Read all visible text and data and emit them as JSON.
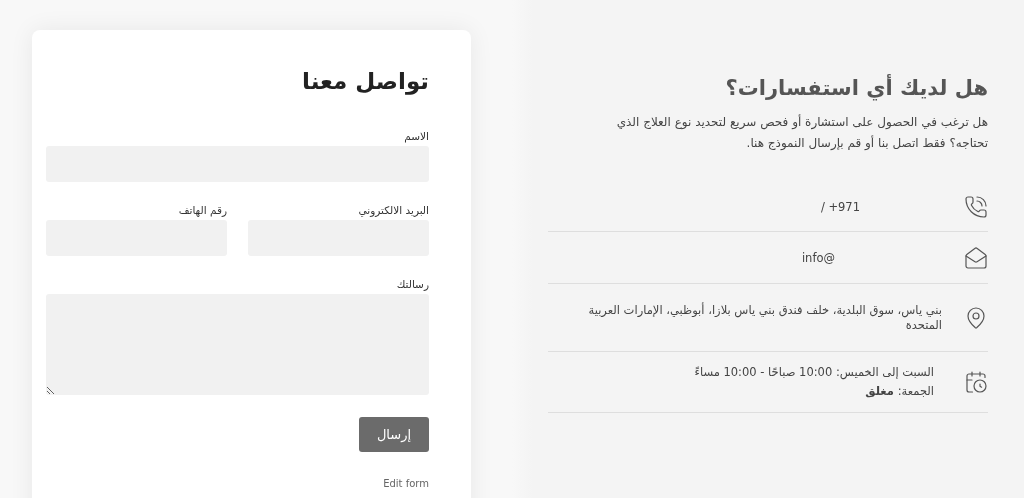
{
  "form": {
    "title": "تواصل معنا",
    "fields": [
      {
        "label": "الاسم",
        "kind": "wide"
      },
      {
        "label": "البريد الالكتروني",
        "kind": "half"
      },
      {
        "label": "رقم الهاتف",
        "kind": "half"
      },
      {
        "label": "رسالتك",
        "kind": "textarea"
      }
    ],
    "submit": "إرسال",
    "edit_link": "Edit form"
  },
  "info": {
    "title": "هل لديك أي استفسارات؟",
    "text": "هل ترغب في الحصول على استشارة أو فحص سريع لتحديد نوع العلاج الذي تحتاجه؟ فقط اتصل بنا أو قم بإرسال النموذج هنا.",
    "items": [
      {
        "kind": "phone",
        "lines": [
          "/ +971"
        ]
      },
      {
        "kind": "email",
        "lines": [
          "info@"
        ]
      },
      {
        "kind": "address",
        "lines": [
          "بني ياس، سوق البلدية، خلف فندق بني ياس بلازا، أبوظبي، الإمارات العربية المتحدة"
        ]
      },
      {
        "kind": "hours",
        "lines": [
          "السبت إلى الخميس: 10:00 صباحًا - 10:00 مساءً",
          "الجمعة: **مغلق**"
        ]
      }
    ]
  }
}
